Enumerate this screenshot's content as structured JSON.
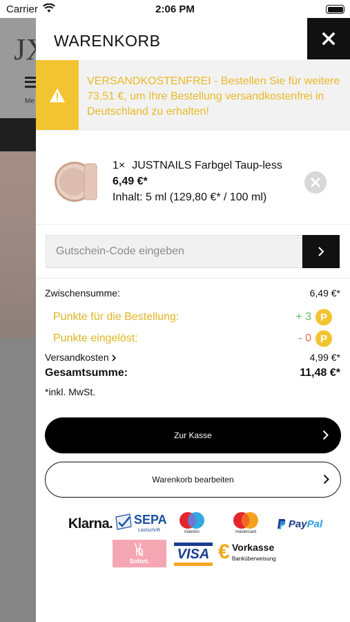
{
  "status_bar": {
    "carrier": "Carrier",
    "time": "2:06 PM"
  },
  "background": {
    "logo": "JX",
    "menu_label": "Me"
  },
  "header": {
    "title": "WARENKORB"
  },
  "notice": {
    "text": "VERSANDKOSTENFREI - Bestellen Sie für weitere 73,51 €, um Ihre Bestellung versandkostenfrei in Deutschland zu erhalten!"
  },
  "cart_item": {
    "quantity": "1×",
    "name": "JUSTNAILS Farbgel Taup-less",
    "price": "6,49 €*",
    "content": "Inhalt: 5 ml (129,80 €* / 100 ml)"
  },
  "voucher": {
    "placeholder": "Gutschein-Code eingeben"
  },
  "summary": {
    "subtotal_label": "Zwischensumme:",
    "subtotal_value": "6,49 €*",
    "points_earned_label": "Punkte für die Bestellung:",
    "points_earned_value": "+ 3",
    "points_redeemed_label": "Punkte eingelöst:",
    "points_redeemed_value": "- 0",
    "points_badge": "P",
    "shipping_label": "Versandkosten",
    "shipping_value": "4,99 €*",
    "total_label": "Gesamtsumme:",
    "total_value": "11,48 €*",
    "tax_note": "*inkl. MwSt."
  },
  "buttons": {
    "checkout": "Zur Kasse",
    "edit_cart": "Warenkorb bearbeiten"
  },
  "payments": {
    "klarna": "Klarna.",
    "sepa": "SEPA",
    "sepa_sub": "Lastschrift",
    "maestro": "maestro",
    "mastercard": "mastercard",
    "paypal_1": "Pay",
    "paypal_2": "Pal",
    "sofort": "Sofort.",
    "visa": "VISA",
    "vorkasse": "Vorkasse",
    "vorkasse_sub": "Banküberweisung"
  },
  "colors": {
    "accent_yellow": "#f3c432",
    "notice_text": "#e9b82a",
    "points_green": "#5bbf5b",
    "points_red": "#e46d54"
  }
}
